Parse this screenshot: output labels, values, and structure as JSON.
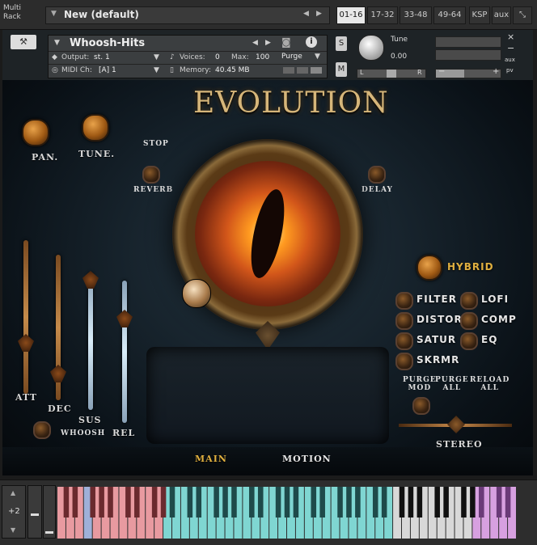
{
  "rack": {
    "label_line1": "Multi",
    "label_line2": "Rack",
    "preset_name": "New (default)",
    "prev_icon": "◀",
    "next_icon": "▶",
    "tabs": [
      {
        "label": "01-16",
        "active": true
      },
      {
        "label": "17-32",
        "active": false
      },
      {
        "label": "33-48",
        "active": false
      },
      {
        "label": "49-64",
        "active": false
      },
      {
        "label": "KSP",
        "active": false
      },
      {
        "label": "aux",
        "active": false
      }
    ],
    "collapse_icon": "⤡"
  },
  "instrument_header": {
    "wrench_icon": "wrench-icon",
    "name": "Whoosh-Hits",
    "output_label": "Output:",
    "output_value": "st. 1",
    "voices_label": "Voices:",
    "voices_value": "0",
    "max_label": "Max:",
    "max_value": "100",
    "purge_label": "Purge",
    "midi_label": "MIDI Ch:",
    "midi_value": "[A] 1",
    "memory_label": "Memory:",
    "memory_value": "40.45 MB",
    "s_label": "S",
    "m_label": "M",
    "tune_label": "Tune",
    "tune_value": "0.00",
    "pan_left": "L",
    "pan_right": "R",
    "vol_minus": "−",
    "vol_plus": "+",
    "aux_label": "aux",
    "pv_label": "pv",
    "close_icon": "×",
    "min_icon": "−",
    "volume_level": 0.44
  },
  "panel": {
    "logo": "EVOLUTION",
    "pan_label": "PAN.",
    "tune_label": "TUNE.",
    "stop_label": "STOP",
    "reverb_label": "REVERB",
    "delay_label": "DELAY",
    "hybrid_label": "HYBRID",
    "fx": [
      "FILTER",
      "LOFI",
      "DISTOR",
      "COMP",
      "SATUR",
      "EQ",
      "SKRMR"
    ],
    "purge_mod_l1": "PURGE",
    "purge_mod_l2": "MOD",
    "purge_all_l1": "PURGE",
    "purge_all_l2": "ALL",
    "reload_all_l1": "RELOAD",
    "reload_all_l2": "ALL",
    "att_label": "ATT",
    "dec_label": "DEC",
    "sus_label": "SUS",
    "whoosh_label": "WHOOSH",
    "rel_label": "REL",
    "stereo_label": "STEREO",
    "main_tab": "MAIN",
    "motion_tab": "MOTION",
    "main_color": "#e0b040",
    "motion_color": "#e6e6e6"
  },
  "keyboard": {
    "octave_value": "+2",
    "octave_up": "▲",
    "octave_down": "▼"
  }
}
